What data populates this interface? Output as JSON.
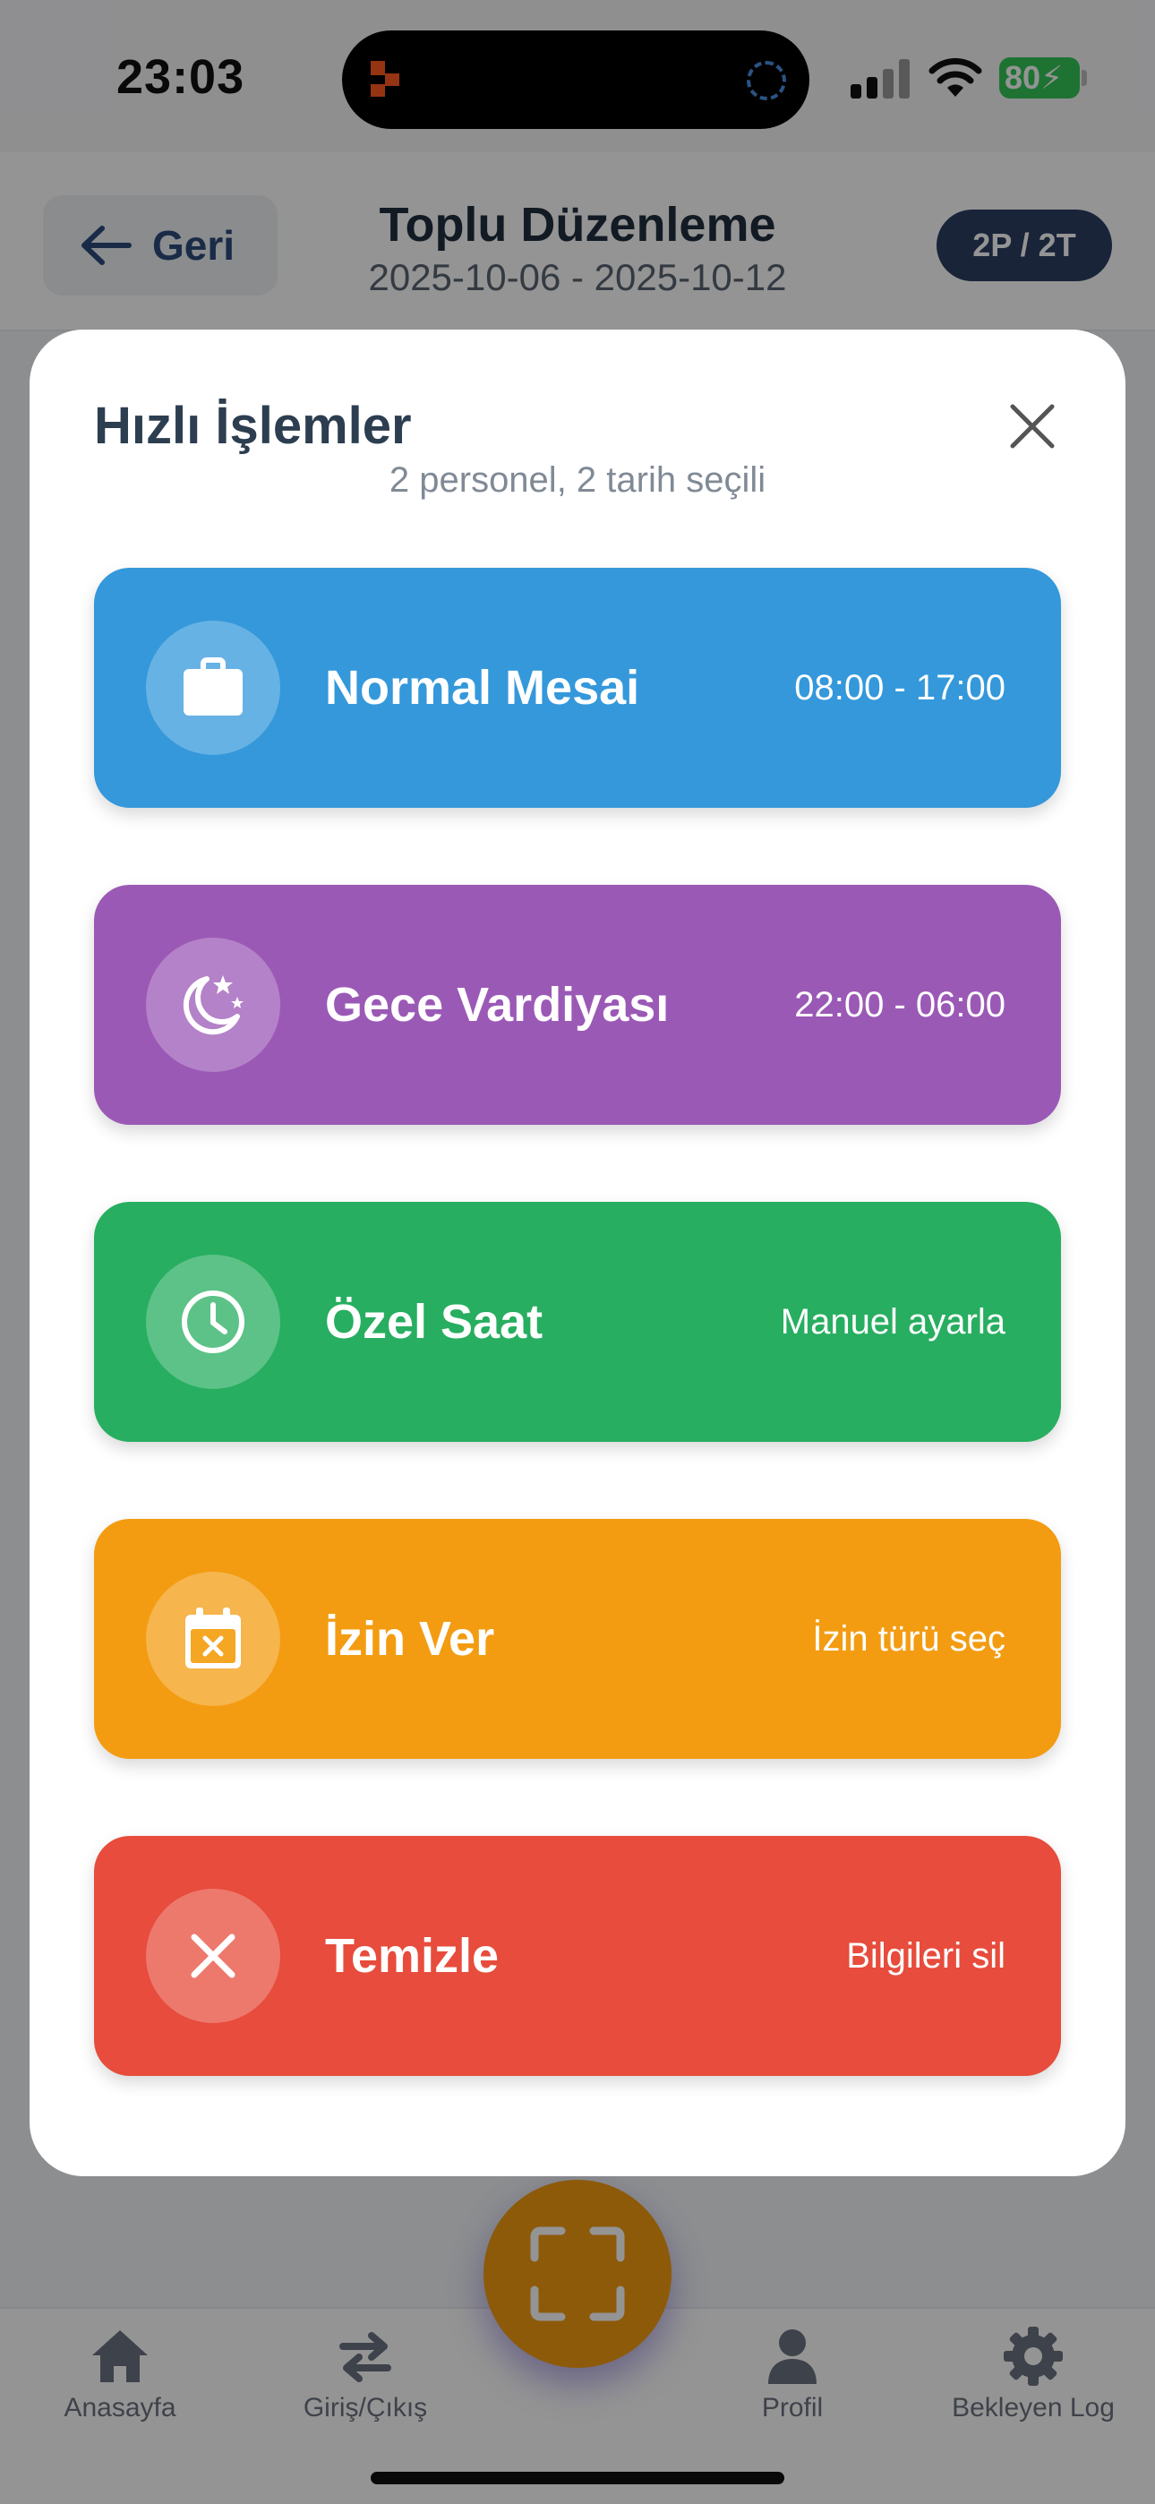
{
  "status_bar": {
    "time": "23:03",
    "battery": "80"
  },
  "header": {
    "back_label": "Geri",
    "title": "Toplu Düzenleme",
    "date_range": "2025-10-06 - 2025-10-12",
    "badge": "2P / 2T"
  },
  "bottom_nav": {
    "items": [
      {
        "label": "Anasayfa",
        "icon": "home-icon"
      },
      {
        "label": "Giriş/Çıkış",
        "icon": "swap-arrows-icon"
      },
      {
        "label": "Profil",
        "icon": "user-icon"
      },
      {
        "label": "Bekleyen Log",
        "icon": "gear-icon"
      }
    ],
    "fab_icon": "scan-icon"
  },
  "modal": {
    "title": "Hızlı İşlemler",
    "subtitle": "2 personel, 2 tarih seçili",
    "actions": [
      {
        "label": "Normal Mesai",
        "meta": "08:00 - 17:00",
        "icon": "briefcase-icon",
        "color": "#3498db"
      },
      {
        "label": "Gece Vardiyası",
        "meta": "22:00 - 06:00",
        "icon": "moon-stars-icon",
        "color": "#9b59b6"
      },
      {
        "label": "Özel Saat",
        "meta": "Manuel ayarla",
        "icon": "clock-icon",
        "color": "#27ae60"
      },
      {
        "label": "İzin Ver",
        "meta": "İzin türü seç",
        "icon": "calendar-x-icon",
        "color": "#f39c12"
      },
      {
        "label": "Temizle",
        "meta": "Bilgileri sil",
        "icon": "x-icon",
        "color": "#e74c3c"
      }
    ]
  },
  "colors": {
    "accent_navy": "#2c3e63",
    "fab": "#f39c12",
    "battery": "#34c759"
  }
}
